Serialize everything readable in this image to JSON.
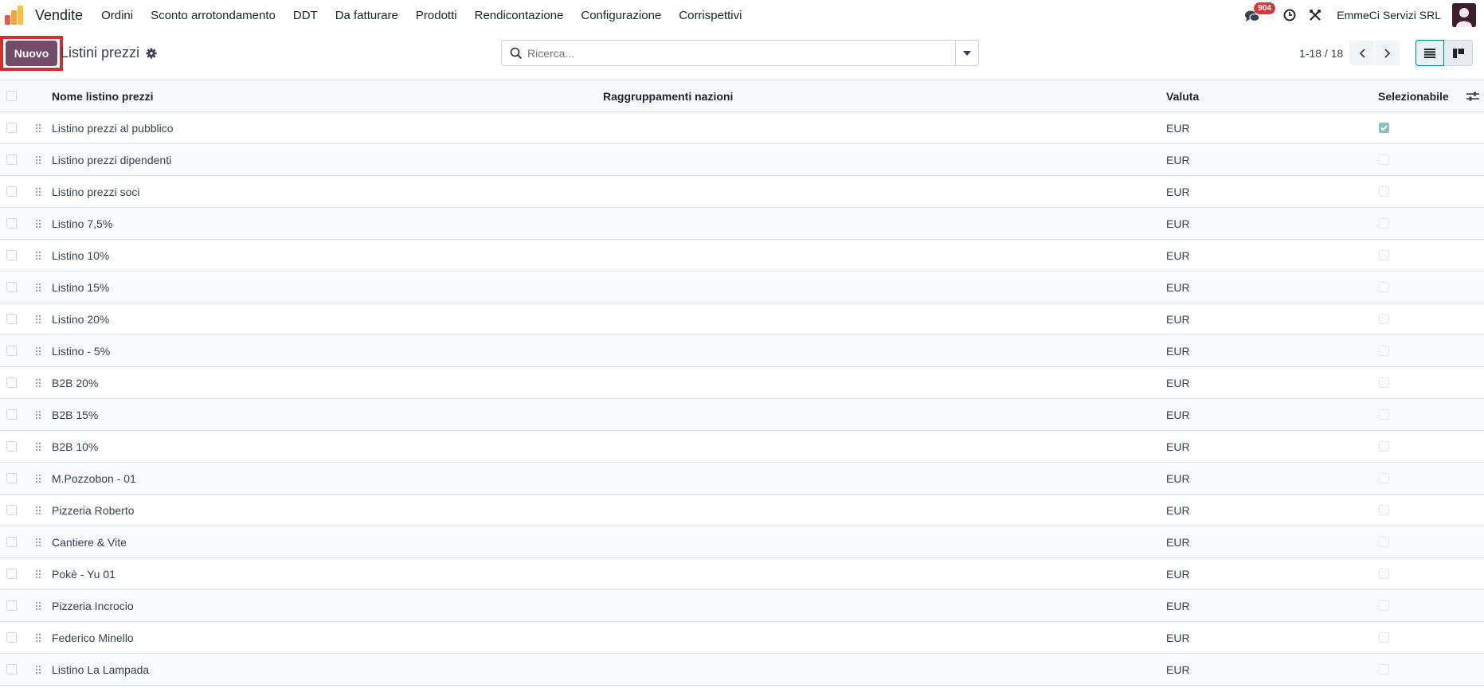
{
  "navbar": {
    "app_name": "Vendite",
    "menu": [
      "Ordini",
      "Sconto arrotondamento",
      "DDT",
      "Da fatturare",
      "Prodotti",
      "Rendicontazione",
      "Configurazione",
      "Corrispettivi"
    ],
    "message_count": "904",
    "company": "EmmeCi Servizi SRL"
  },
  "control": {
    "new_label": "Nuovo",
    "breadcrumb": "Listini prezzi",
    "search_placeholder": "Ricerca...",
    "pager": "1-18 / 18"
  },
  "table": {
    "columns": [
      "Nome listino prezzi",
      "Raggruppamenti nazioni",
      "Valuta",
      "Selezionabile"
    ],
    "rows": [
      {
        "name": "Listino prezzi al pubblico",
        "currency": "EUR",
        "selectable": true
      },
      {
        "name": "Listino prezzi dipendenti",
        "currency": "EUR",
        "selectable": false
      },
      {
        "name": "Listino prezzi soci",
        "currency": "EUR",
        "selectable": false
      },
      {
        "name": "Listino 7,5%",
        "currency": "EUR",
        "selectable": false
      },
      {
        "name": "Listino 10%",
        "currency": "EUR",
        "selectable": false
      },
      {
        "name": "Listino 15%",
        "currency": "EUR",
        "selectable": false
      },
      {
        "name": "Listino 20%",
        "currency": "EUR",
        "selectable": false
      },
      {
        "name": "Listino - 5%",
        "currency": "EUR",
        "selectable": false
      },
      {
        "name": "B2B 20%",
        "currency": "EUR",
        "selectable": false
      },
      {
        "name": "B2B 15%",
        "currency": "EUR",
        "selectable": false
      },
      {
        "name": "B2B 10%",
        "currency": "EUR",
        "selectable": false
      },
      {
        "name": "M.Pozzobon - 01",
        "currency": "EUR",
        "selectable": false
      },
      {
        "name": "Pizzeria Roberto",
        "currency": "EUR",
        "selectable": false
      },
      {
        "name": "Cantiere & Vite",
        "currency": "EUR",
        "selectable": false
      },
      {
        "name": "Pokè - Yu 01",
        "currency": "EUR",
        "selectable": false
      },
      {
        "name": "Pizzeria Incrocio",
        "currency": "EUR",
        "selectable": false
      },
      {
        "name": "Federico Minello",
        "currency": "EUR",
        "selectable": false
      },
      {
        "name": "Listino La Lampada",
        "currency": "EUR",
        "selectable": false
      }
    ]
  },
  "colors": {
    "brand": "#714b67",
    "highlight_frame": "#d32f2f",
    "badge": "#d9363e",
    "checked": "#8ebfc2",
    "active_view": "#017e84"
  }
}
